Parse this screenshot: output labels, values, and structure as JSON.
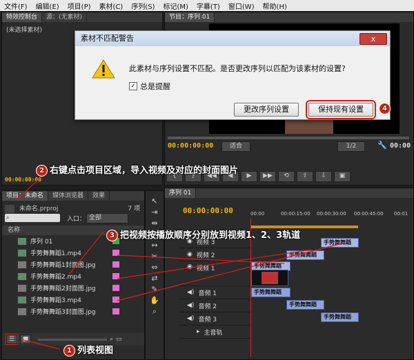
{
  "menu": [
    "文件(F)",
    "编辑(E)",
    "项目(P)",
    "素材(C)",
    "序列(S)",
    "标记(M)",
    "字幕(T)",
    "窗口(W)",
    "帮助(H)"
  ],
  "source_panel": {
    "tabs": [
      "特效控制台",
      "源：(无素材)"
    ],
    "no_clip": "(未选择素材)",
    "timecode": "00:00:00:00"
  },
  "program_panel": {
    "tab": "节目：序列 01",
    "timecode_left": "00:00:00:00",
    "fit": "适合",
    "ratio": "1/2",
    "timecode_right": "00:00"
  },
  "dialog": {
    "title": "素材不匹配警告",
    "close": "x",
    "message": "此素材与序列设置不匹配。是否更改序列以匹配为该素材的设置?",
    "checkbox_label": "总是提醒",
    "change_button": "更改序列设置",
    "keep_button": "保持现有设置"
  },
  "project_panel": {
    "tabs": [
      "项目：未命名",
      "媒体浏览器",
      "效果"
    ],
    "project_file": "未命名.prproj",
    "item_count": "7 项",
    "search_placeholder": "",
    "in_label": "入口：",
    "in_value": "全部",
    "name_header": "名称",
    "items": [
      {
        "name": "序列 01",
        "color": "#3cb043"
      },
      {
        "name": "手势舞舞蹈1.mp4",
        "color": "#e070d0"
      },
      {
        "name": "手势舞舞蹈1封面图.jpg",
        "color": "#e070d0"
      },
      {
        "name": "手势舞舞蹈2.mp4",
        "color": "#e070d0"
      },
      {
        "name": "手势舞舞蹈2封面图.jpg",
        "color": "#e070d0"
      },
      {
        "name": "手势舞舞蹈3.mp4",
        "color": "#e070d0"
      },
      {
        "name": "手势舞舞蹈3封面图.jpg",
        "color": "#e070d0"
      }
    ]
  },
  "timeline": {
    "tab": "序列 01",
    "timecode": "00:00:00:00",
    "ruler": [
      "00:00",
      "00:00:15:00",
      "00:00:30:00",
      "00:00:45:00",
      "00:01"
    ],
    "tracks": {
      "video": [
        "视频 3",
        "视频 2",
        "视频 1"
      ],
      "audio": [
        "音频 1",
        "音频 2",
        "音频 3"
      ],
      "master": "主音轨"
    },
    "clip_label": "手势舞舞蹈"
  },
  "callouts": {
    "c1_num": "1",
    "c1": "列表视图",
    "c2_num": "2",
    "c2": "右键点击项目区域，导入视频及对应的封面图片",
    "c3_num": "3",
    "c3": "把视频按播放顺序分别放到视频1、2、3轨道",
    "c4_num": "4"
  }
}
